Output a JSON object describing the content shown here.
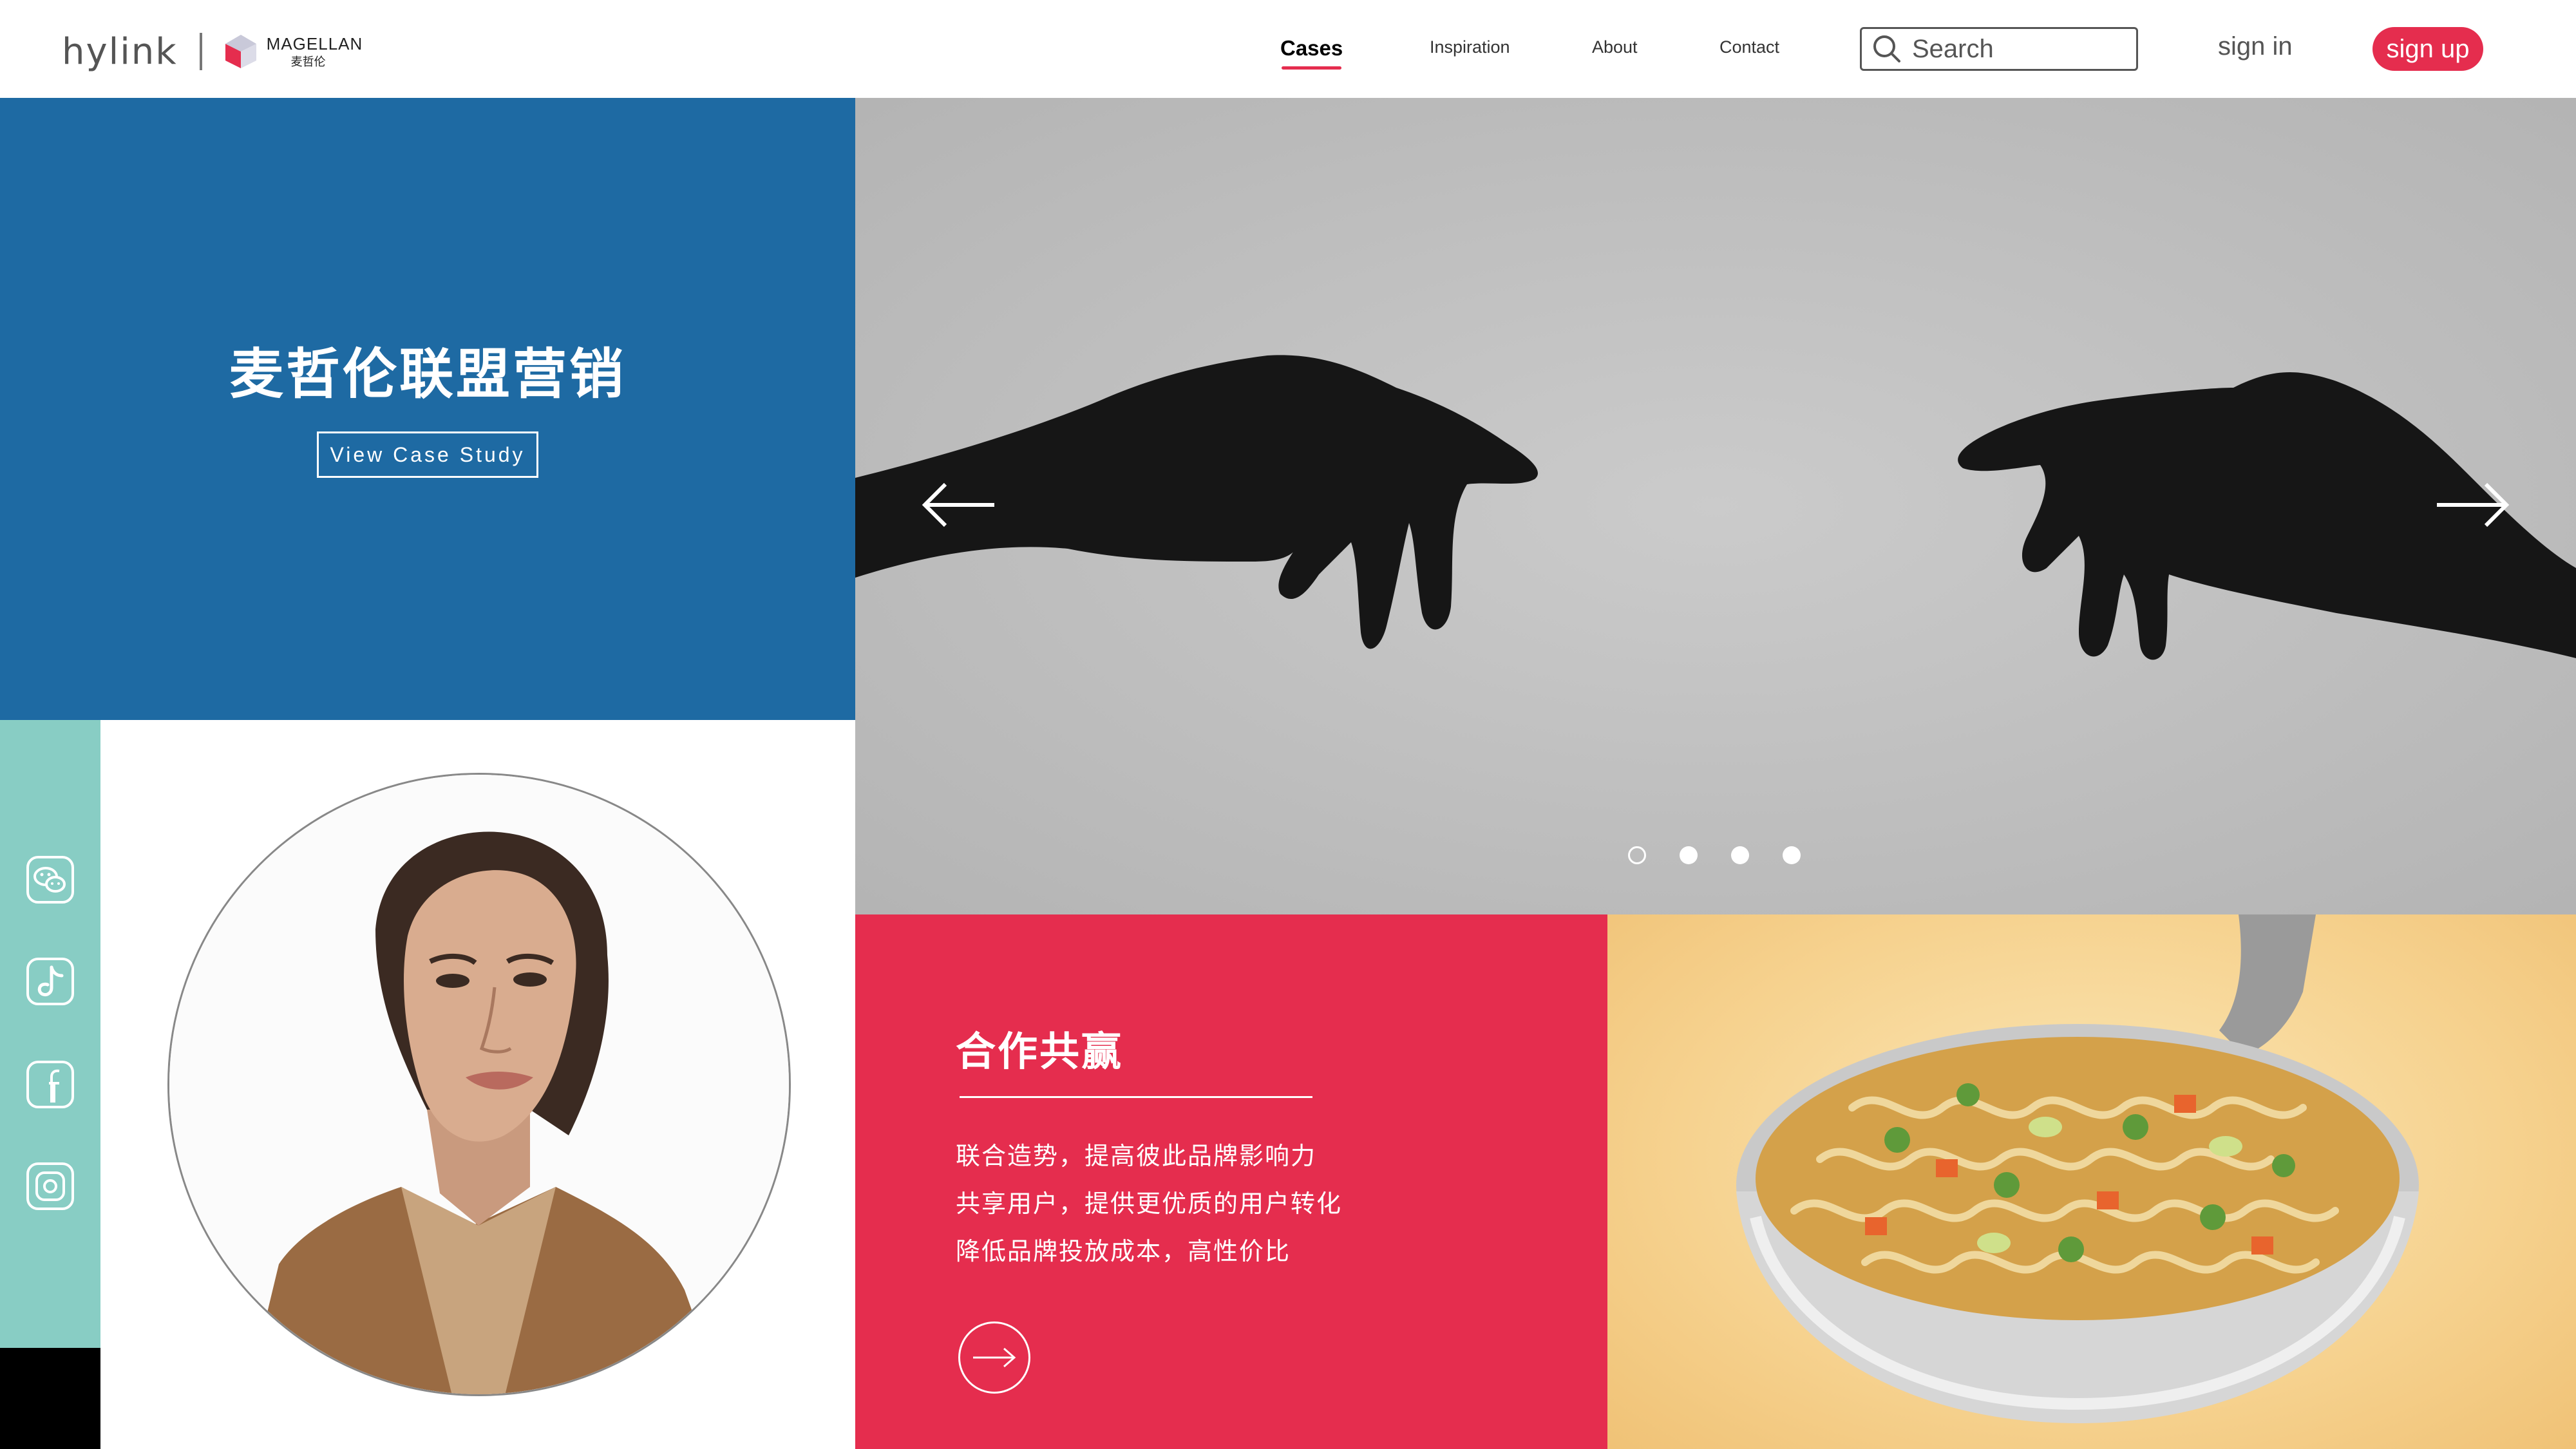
{
  "header": {
    "logo_text": "hylink",
    "partner_logo_en": "MAGELLAN",
    "partner_logo_cn": "麦哲伦",
    "nav": [
      {
        "label": "Cases",
        "active": true
      },
      {
        "label": "Inspiration",
        "active": false
      },
      {
        "label": "About",
        "active": false
      },
      {
        "label": "Contact",
        "active": false
      }
    ],
    "search_placeholder": "Search",
    "signin_label": "sign in",
    "signup_label": "sign up",
    "accent_color": "#e52d4e"
  },
  "feature": {
    "title": "麦哲伦联盟营销",
    "button_label": "View  Case Study",
    "background": "#1e6aa3"
  },
  "slider": {
    "image": "hands-reaching-silhouette",
    "prev_icon": "arrow-left-icon",
    "next_icon": "arrow-right-icon",
    "slide_count": 4,
    "active_index": 0
  },
  "social": {
    "icons": [
      "wechat-icon",
      "tiktok-icon",
      "facebook-icon",
      "instagram-icon"
    ],
    "background": "#88cdc4"
  },
  "portrait": {
    "image": "woman-portrait"
  },
  "promo": {
    "title": "合作共赢",
    "lines": [
      "联合造势，提高彼此品牌影响力",
      "共享用户，提供更优质的用户转化",
      "降低品牌投放成本，高性价比"
    ],
    "arrow_icon": "arrow-right-icon",
    "background": "#e52d4e"
  },
  "food": {
    "image": "noodle-soup-bowl"
  }
}
